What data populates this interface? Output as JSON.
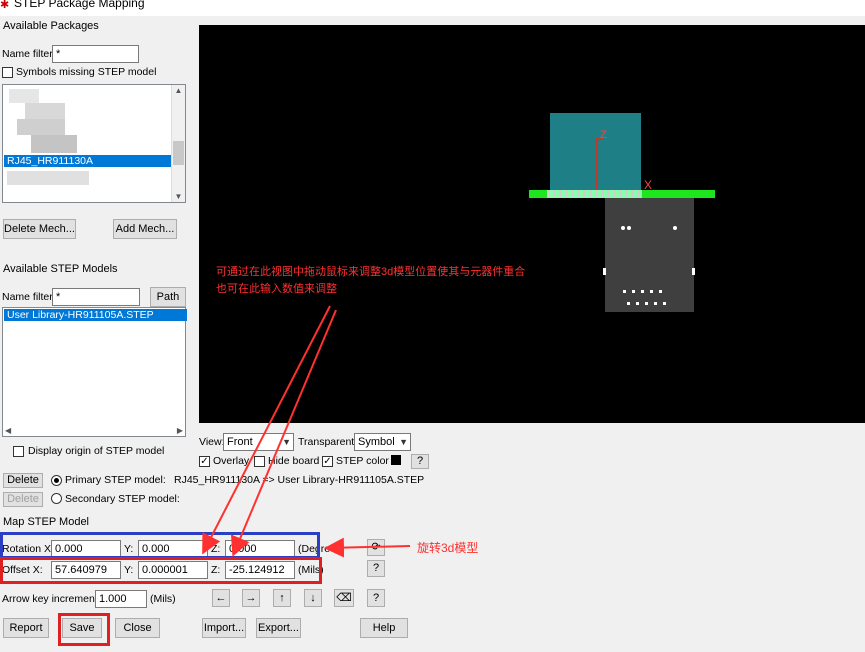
{
  "window": {
    "title": "STEP Package Mapping"
  },
  "packages": {
    "group_label": "Available Packages",
    "name_filter_label": "Name filter:",
    "name_filter_value": "*",
    "symbols_missing_label": "Symbols missing STEP model",
    "selected_item": "RJ45_HR911130A",
    "delete_mech_label": "Delete Mech...",
    "add_mech_label": "Add Mech..."
  },
  "step_models": {
    "group_label": "Available STEP Models",
    "name_filter_label": "Name filter:",
    "name_filter_value": "*",
    "path_label": "Path",
    "items": [
      "User Library-HR911105A.STEP"
    ],
    "display_origin_label": "Display origin of STEP model"
  },
  "view": {
    "view_label": "View:",
    "view_value": "Front",
    "transparent_label": "Transparent:",
    "transparent_value": "Symbol",
    "overlay_label": "Overlay",
    "hide_board_label": "Hide board",
    "step_color_label": "STEP color",
    "help_q": "?"
  },
  "mapping": {
    "delete_label": "Delete",
    "primary_label": "Primary STEP model:",
    "primary_text": "RJ45_HR911130A => User Library-HR911105A.STEP",
    "secondary_label": "Secondary STEP model:"
  },
  "map_step": {
    "group_label": "Map STEP Model",
    "rotation_label": "Rotation X:",
    "rotation_x": "0.000",
    "y_label": "Y:",
    "rotation_y": "0.000",
    "z_label": "Z:",
    "rotation_z": "0.000",
    "rotation_unit": "(Degrees)",
    "offset_label": "Offset X:",
    "offset_x": "57.640979",
    "offset_y": "0.000001",
    "offset_z": "-25.124912",
    "offset_unit": "(Mils)",
    "arrow_label": "Arrow key increment:",
    "arrow_value": "1.000",
    "arrow_unit": "(Mils)",
    "help_q": "?"
  },
  "bottom_buttons": {
    "report": "Report",
    "save": "Save",
    "close": "Close",
    "import": "Import...",
    "export": "Export...",
    "help": "Help"
  },
  "annotations": {
    "note_line1": "可通过在此视图中拖动鼠标来调整3d模型位置使其与元器件重合",
    "note_line2": "也可在此输入数值来调整",
    "rotate_note": "旋转3d模型"
  },
  "model_axes": {
    "z_label": "Z",
    "x_label": "X"
  },
  "colors": {
    "highlight_blue": "#2b3fc4",
    "highlight_red": "#e02020",
    "annotation_red": "#ff3030",
    "viewport_bg": "#000000",
    "model_teal": "#1f7f86",
    "board_green": "#1ee61e",
    "component_gray": "#3f3f3f",
    "selection_blue": "#0078d7"
  }
}
